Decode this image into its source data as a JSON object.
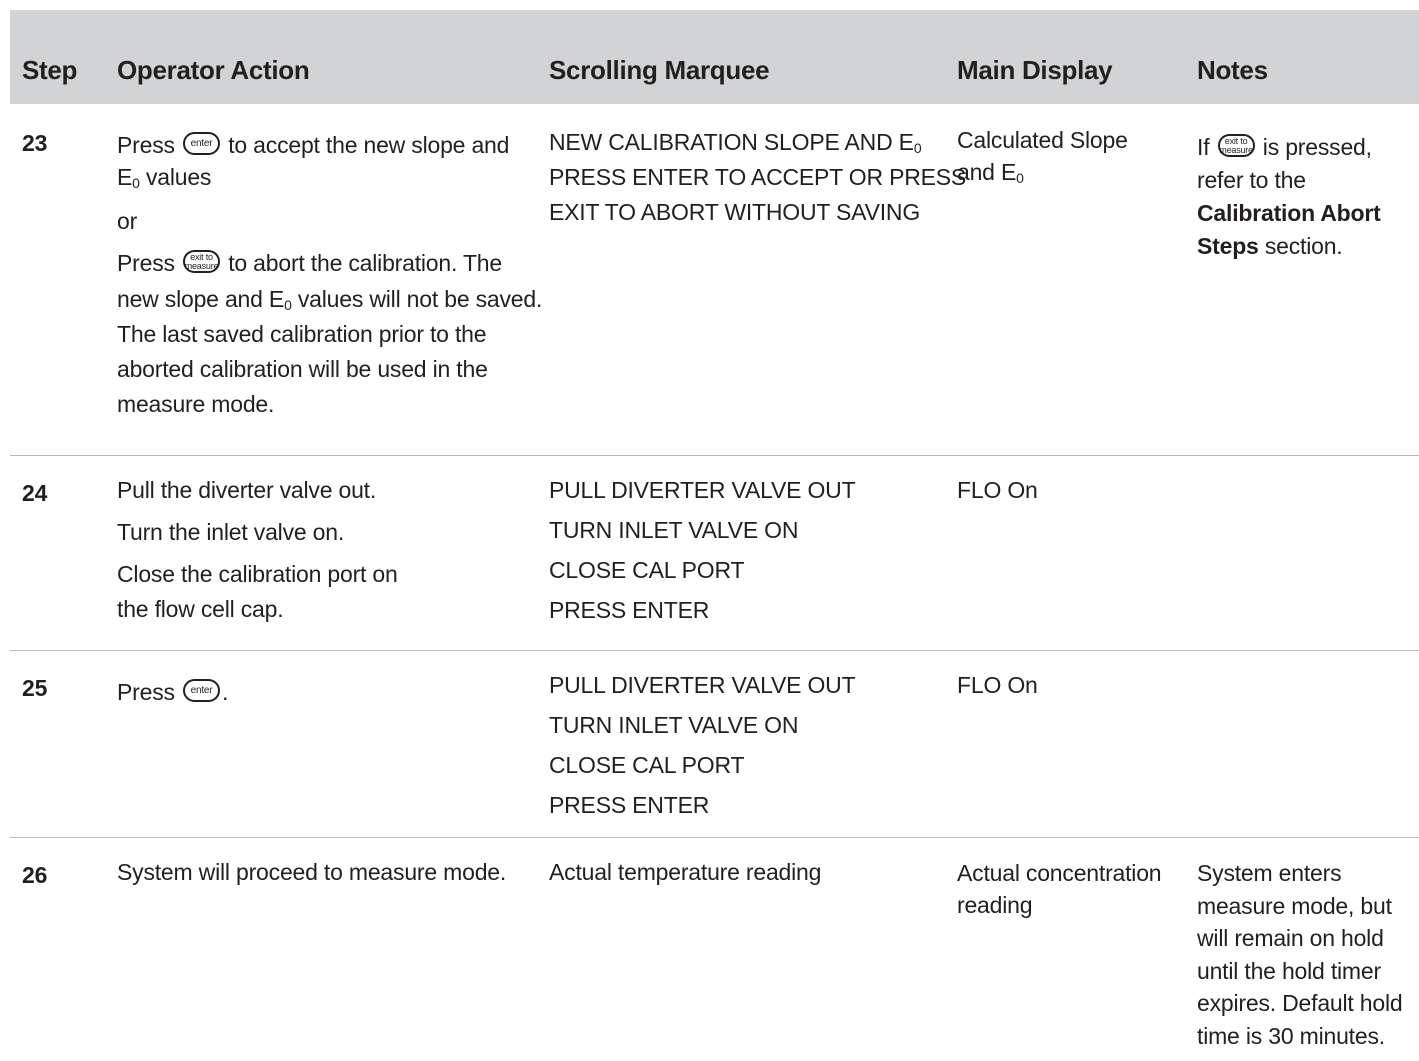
{
  "table": {
    "headers": {
      "step": "Step",
      "operator_action": "Operator Action",
      "scrolling_marquee": "Scrolling Marquee",
      "main_display": "Main Display",
      "notes": "Notes"
    },
    "keys": {
      "enter": "enter",
      "exit_line1": "exit to",
      "exit_line2": "measure"
    },
    "rows": [
      {
        "step": "23",
        "action": {
          "l1_pre": "Press",
          "l1_post": "to accept the new slope and",
          "l2_e": "E",
          "l2_sub": "0",
          "l2_post": " values",
          "or": "or",
          "l4_pre": "Press",
          "l4_post": "to abort the calibration. The",
          "l5_pre": "new slope and E",
          "l5_sub": "0",
          "l5_post": " values will not be saved.",
          "l6": "The last saved calibration prior to the",
          "l7": "aborted calibration will be used in the",
          "l8": "measure mode."
        },
        "marquee": {
          "l1_pre": "NEW CALIBRATION SLOPE AND E",
          "l1_sub": "0",
          "l2": "PRESS ENTER TO ACCEPT OR PRESS",
          "l3": "EXIT TO ABORT WITHOUT SAVING"
        },
        "display": {
          "l1": "Calculated Slope",
          "l2_pre": "and E",
          "l2_sub": "0"
        },
        "notes": {
          "l1_pre": "If",
          "l1_post": "is pressed,",
          "l2": "refer to the",
          "l3": "Calibration Abort",
          "l4_bold": "Steps",
          "l4_post": " section."
        }
      },
      {
        "step": "24",
        "action": {
          "l1": "Pull the diverter valve out.",
          "l2": "Turn the inlet valve on.",
          "l3": "Close the calibration port on",
          "l4": "the flow cell cap."
        },
        "marquee": {
          "l1": "PULL DIVERTER VALVE OUT",
          "l2": "TURN INLET VALVE ON",
          "l3": "CLOSE CAL PORT",
          "l4": "PRESS ENTER"
        },
        "display": {
          "l1": "FLO On"
        }
      },
      {
        "step": "25",
        "action": {
          "pre": "Press",
          "post": "."
        },
        "marquee": {
          "l1": "PULL DIVERTER VALVE OUT",
          "l2": "TURN INLET VALVE ON",
          "l3": "CLOSE CAL PORT",
          "l4": "PRESS ENTER"
        },
        "display": {
          "l1": "FLO On"
        }
      },
      {
        "step": "26",
        "action": {
          "l1": "System will proceed to measure mode."
        },
        "marquee": {
          "l1": "Actual temperature reading"
        },
        "display": {
          "l1": "Actual concentration",
          "l2": "reading"
        },
        "notes": {
          "l1": "System enters",
          "l2": "measure mode, but",
          "l3": "will remain on hold",
          "l4": "until the hold timer",
          "l5": "expires. Default hold",
          "l6": "time is 30 minutes."
        }
      }
    ]
  }
}
